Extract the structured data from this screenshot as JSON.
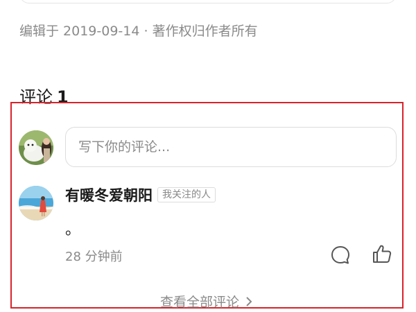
{
  "article": {
    "meta": "编辑于 2019-09-14 · 著作权归作者所有"
  },
  "comments": {
    "heading": "评论",
    "count": "1",
    "input_placeholder": "写下你的评论...",
    "items": [
      {
        "author": "有暖冬爱朝阳",
        "badge": "我关注的人",
        "text": "。",
        "time": "28 分钟前"
      }
    ],
    "view_all": "查看全部评论"
  },
  "icons": {
    "reply": "comment-bubble-icon",
    "like": "thumbs-up-icon",
    "view_all": "chevron-right-icon"
  },
  "colors": {
    "highlight_border": "#d8232a",
    "secondary_text": "#8a8a8a"
  }
}
